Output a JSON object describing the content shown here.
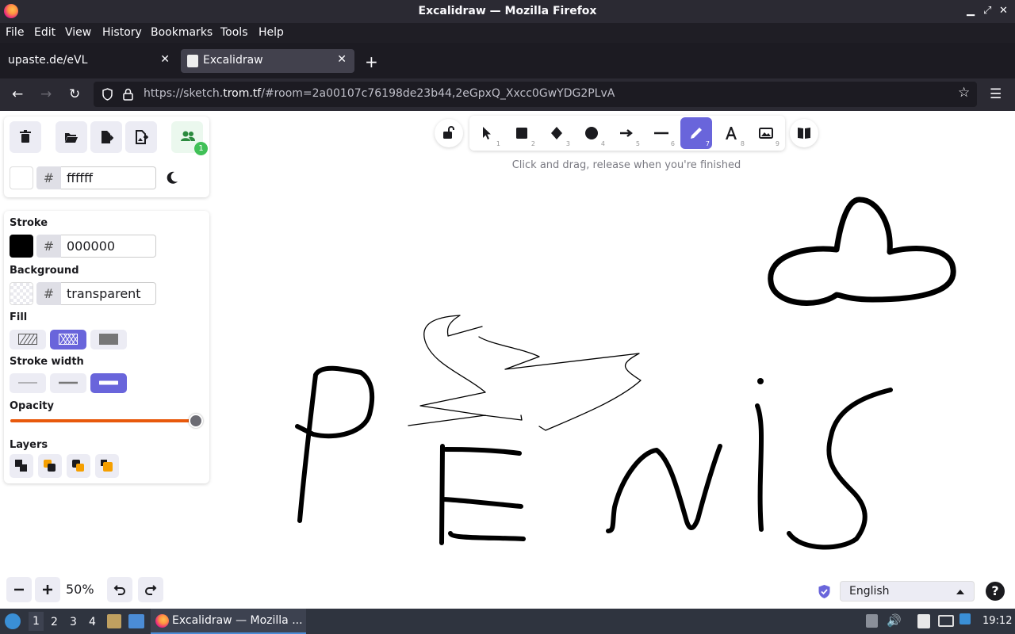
{
  "window": {
    "title": "Excalidraw — Mozilla Firefox",
    "controls": [
      "minimize",
      "maximize",
      "close"
    ]
  },
  "menu": [
    "File",
    "Edit",
    "View",
    "History",
    "Bookmarks",
    "Tools",
    "Help"
  ],
  "tabs": [
    {
      "label": "upaste.de/eVL",
      "active": false
    },
    {
      "label": "Excalidraw",
      "active": true
    }
  ],
  "url": {
    "prefix": "https://sketch.",
    "domain": "trom.tf",
    "suffix": "/#room=2a00107c76198de23b44,2eGpxQ_Xxcc0GwYDG2PLvA"
  },
  "app_panel": {
    "collab_count": "1",
    "canvas_hex": "ffffff"
  },
  "props": {
    "stroke_label": "Stroke",
    "stroke_hex": "000000",
    "stroke_color": "#000000",
    "background_label": "Background",
    "background_hex": "transparent",
    "fill_label": "Fill",
    "fill_selected": "cross-hatch",
    "stroke_width_label": "Stroke width",
    "stroke_width_selected": "extra-bold",
    "opacity_label": "Opacity",
    "opacity_value": 1.0,
    "layers_label": "Layers"
  },
  "toolbar": {
    "tools": [
      {
        "name": "selection",
        "key": "1"
      },
      {
        "name": "rectangle",
        "key": "2"
      },
      {
        "name": "diamond",
        "key": "3"
      },
      {
        "name": "ellipse",
        "key": "4"
      },
      {
        "name": "arrow",
        "key": "5"
      },
      {
        "name": "line",
        "key": "6"
      },
      {
        "name": "draw",
        "key": "7"
      },
      {
        "name": "text",
        "key": "8"
      },
      {
        "name": "image",
        "key": "9"
      }
    ],
    "selected": "draw",
    "hint": "Click and drag, release when you're finished"
  },
  "footer": {
    "zoom": "50%",
    "language": "English",
    "help": "?"
  },
  "taskbar": {
    "workspaces": [
      "1",
      "2",
      "3",
      "4"
    ],
    "active_workspace": "1",
    "app_label": "Excalidraw — Mozilla ...",
    "clock": "19:12"
  },
  "colors": {
    "accent": "#6965db",
    "opacity_track": "#e8590c"
  }
}
